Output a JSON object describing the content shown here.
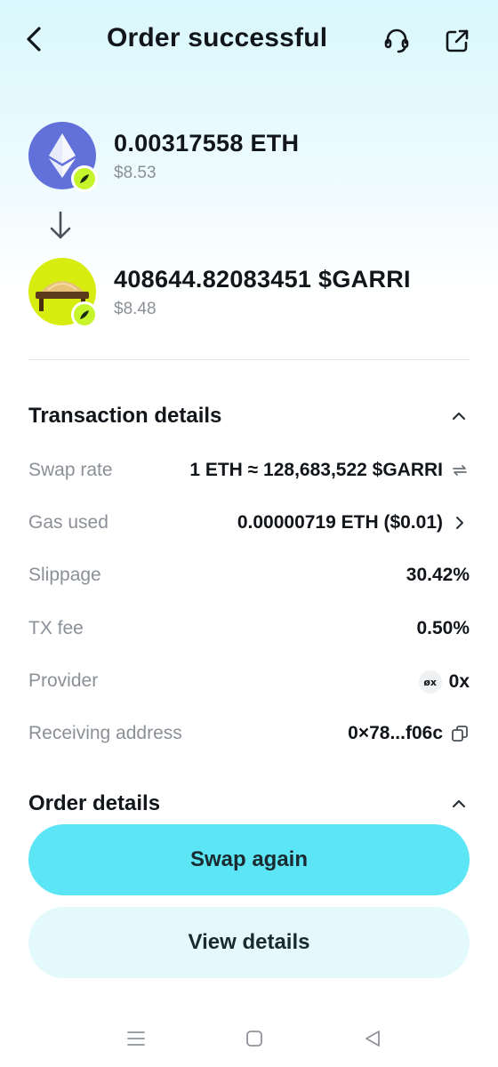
{
  "header": {
    "title": "Order successful",
    "icons": {
      "back": "back-arrow-icon",
      "support": "headset-icon",
      "share": "share-icon"
    }
  },
  "swap": {
    "from": {
      "amount": "0.00317558 ETH",
      "usd": "$8.53",
      "icon": "ethereum-icon",
      "color": "#6271d9"
    },
    "to": {
      "amount": "408644.82083451 $GARRI",
      "usd": "$8.48",
      "icon": "garri-token-icon",
      "color": "#d7ec0f"
    },
    "chain_badge_color": "#c5f52a"
  },
  "transaction_details": {
    "title": "Transaction details",
    "rows": [
      {
        "label": "Swap rate",
        "value": "1 ETH ≈ 128,683,522 $GARRI",
        "icon": "swap-arrows-icon"
      },
      {
        "label": "Gas used",
        "value": "0.00000719 ETH ($0.01)",
        "icon": "chevron-right-icon"
      },
      {
        "label": "Slippage",
        "value": "30.42%"
      },
      {
        "label": "TX fee",
        "value": "0.50%"
      },
      {
        "label": "Provider",
        "value": "0x",
        "badge": "øx"
      },
      {
        "label": "Receiving address",
        "value": "0×78...f06c",
        "icon": "copy-icon"
      }
    ]
  },
  "order_details": {
    "title": "Order details"
  },
  "buttons": {
    "swap_again": "Swap again",
    "view_details": "View details",
    "primary_color": "#5ce6f5",
    "secondary_color": "#e3f9fc"
  },
  "nav": {
    "icons": [
      "menu-icon",
      "home-icon",
      "back-icon"
    ]
  }
}
